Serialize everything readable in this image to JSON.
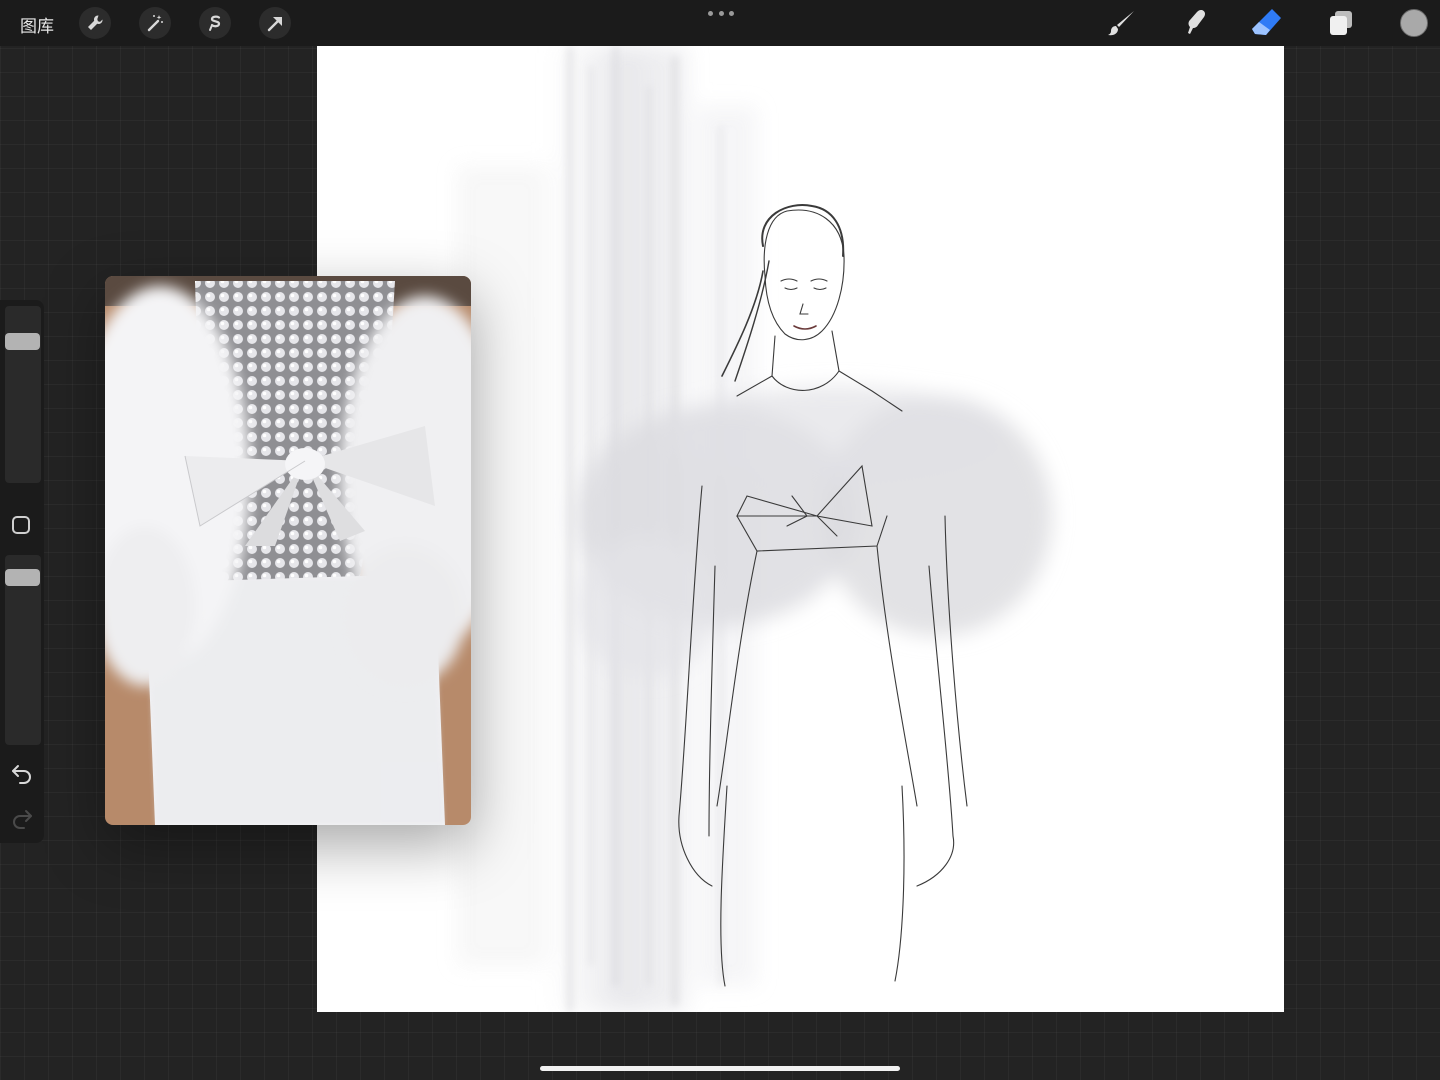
{
  "top_bar": {
    "gallery_label": "图库",
    "left_tools": [
      "wrench-icon",
      "magic-wand-icon",
      "selection-icon",
      "transform-arrow-icon"
    ],
    "right_tools": [
      "brush-icon",
      "smudge-icon",
      "eraser-icon",
      "layers-icon"
    ],
    "active_tool": "eraser",
    "current_color": "#a9a9a9",
    "accent_color": "#2f7bf6"
  },
  "side_bar": {
    "brush_size_level": 0.9,
    "opacity_level": 1.0,
    "buttons": [
      "modify-square-icon",
      "undo-icon",
      "redo-icon"
    ]
  }
}
